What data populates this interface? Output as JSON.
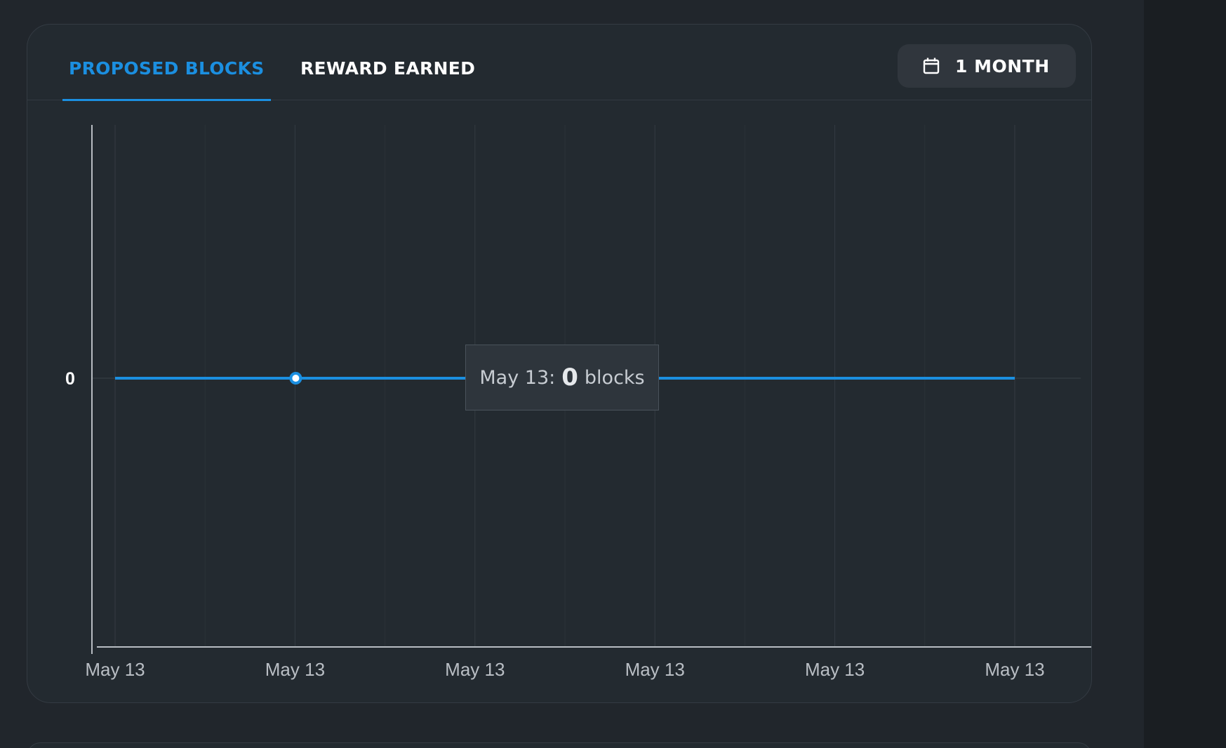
{
  "tabs": {
    "active_label": "PROPOSED BLOCKS",
    "inactive_label": "REWARD EARNED"
  },
  "period_button": {
    "label": "1 MONTH",
    "icon": "calendar-icon"
  },
  "tooltip": {
    "date": "May 13:",
    "value": "0",
    "unit": "blocks"
  },
  "colors": {
    "accent": "#1b8fe0",
    "background": "#21262c",
    "card": "#232a30"
  },
  "chart_data": {
    "type": "line",
    "x": [
      "May 13",
      "May 13",
      "May 13",
      "May 13",
      "May 13",
      "May 13"
    ],
    "series": [
      {
        "values": [
          0,
          0,
          0,
          0,
          0,
          0
        ]
      }
    ],
    "ytick_labels": [
      "0"
    ],
    "highlighted_index": 1,
    "grid": true,
    "title": "",
    "xlabel": "",
    "ylabel": ""
  }
}
